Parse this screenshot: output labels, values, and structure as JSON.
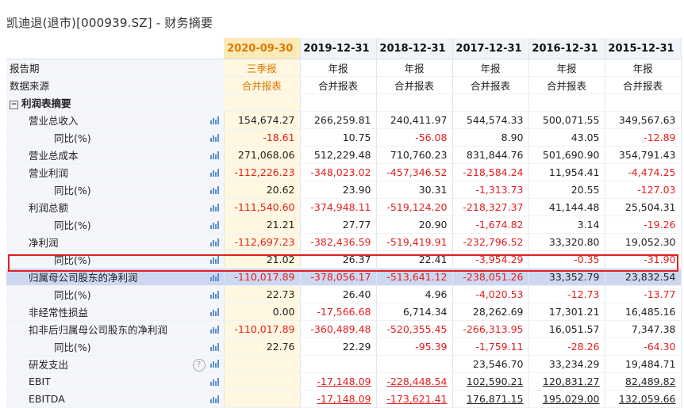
{
  "window_title": "凯迪退(退市)[000939.SZ] - 财务摘要",
  "columns": [
    "2020-09-30",
    "2019-12-31",
    "2018-12-31",
    "2017-12-31",
    "2016-12-31",
    "2015-12-31"
  ],
  "report_period": {
    "label": "报告期",
    "values": [
      "三季报",
      "年报",
      "年报",
      "年报",
      "年报",
      "年报"
    ]
  },
  "data_source": {
    "label": "数据来源",
    "values": [
      "合并报表",
      "合并报表",
      "合并报表",
      "合并报表",
      "合并报表",
      "合并报表"
    ]
  },
  "section": {
    "label": "利润表摘要",
    "toggle": "−"
  },
  "rows": [
    {
      "label": "营业总收入",
      "level": 1,
      "values": [
        "154,674.27",
        "266,259.81",
        "240,411.97",
        "544,574.33",
        "500,071.55",
        "349,567.63"
      ]
    },
    {
      "label": "同比(%)",
      "level": 2,
      "values": [
        "-18.61",
        "10.75",
        "-56.08",
        "8.90",
        "43.05",
        "-12.89"
      ]
    },
    {
      "label": "营业总成本",
      "level": 1,
      "values": [
        "271,068.06",
        "512,229.48",
        "710,760.23",
        "831,844.76",
        "501,690.90",
        "354,791.43"
      ]
    },
    {
      "label": "营业利润",
      "level": 1,
      "values": [
        "-112,226.23",
        "-348,023.02",
        "-457,346.52",
        "-218,584.24",
        "11,954.41",
        "-4,474.25"
      ]
    },
    {
      "label": "同比(%)",
      "level": 2,
      "values": [
        "20.62",
        "23.90",
        "30.31",
        "-1,313.73",
        "20.55",
        "-127.03"
      ]
    },
    {
      "label": "利润总额",
      "level": 1,
      "values": [
        "-111,540.60",
        "-374,948.11",
        "-519,124.20",
        "-218,327.37",
        "41,144.48",
        "25,504.31"
      ]
    },
    {
      "label": "同比(%)",
      "level": 2,
      "values": [
        "21.21",
        "27.77",
        "20.90",
        "-1,674.82",
        "3.14",
        "-19.26"
      ]
    },
    {
      "label": "净利润",
      "level": 1,
      "values": [
        "-112,697.23",
        "-382,436.59",
        "-519,419.91",
        "-232,796.52",
        "33,320.80",
        "19,052.30"
      ]
    },
    {
      "label": "同比(%)",
      "level": 2,
      "values": [
        "21.02",
        "26.37",
        "22.41",
        "-3,954.29",
        "-0.35",
        "-31.90"
      ]
    },
    {
      "label": "归属母公司股东的净利润",
      "level": 1,
      "highlight": true,
      "values": [
        "-110,017.89",
        "-378,056.17",
        "-513,641.12",
        "-238,051.26",
        "33,352.79",
        "23,832.54"
      ]
    },
    {
      "label": "同比(%)",
      "level": 2,
      "values": [
        "22.73",
        "26.40",
        "4.96",
        "-4,020.53",
        "-12.73",
        "-13.77"
      ]
    },
    {
      "label": "非经常性损益",
      "level": 1,
      "values": [
        "0.00",
        "-17,566.68",
        "6,714.34",
        "28,262.69",
        "17,301.21",
        "16,485.16"
      ]
    },
    {
      "label": "扣非后归属母公司股东的净利润",
      "level": 1,
      "values": [
        "-110,017.89",
        "-360,489.48",
        "-520,355.45",
        "-266,313.95",
        "16,051.57",
        "7,347.38"
      ]
    },
    {
      "label": "同比(%)",
      "level": 2,
      "values": [
        "22.76",
        "22.29",
        "-95.39",
        "-1,759.11",
        "-28.26",
        "-64.30"
      ]
    },
    {
      "label": "研发支出",
      "level": 1,
      "help": "?",
      "values": [
        "",
        "",
        "",
        "23,546.70",
        "33,234.29",
        "19,484.71"
      ]
    },
    {
      "label": "EBIT",
      "level": 1,
      "underline": true,
      "values": [
        "",
        "-17,148.09",
        "-228,448.54",
        "102,590.21",
        "120,831.27",
        "82,489.82"
      ]
    },
    {
      "label": "EBITDA",
      "level": 1,
      "underline": true,
      "values": [
        "",
        "-17,148.09",
        "-173,621.41",
        "176,871.15",
        "195,029.00",
        "132,059.66"
      ]
    }
  ],
  "colors": {
    "negative": "#e41e1e",
    "accent": "#e07800",
    "highlight_box": "#e02020",
    "highlight_row": "#cdd8f0"
  }
}
